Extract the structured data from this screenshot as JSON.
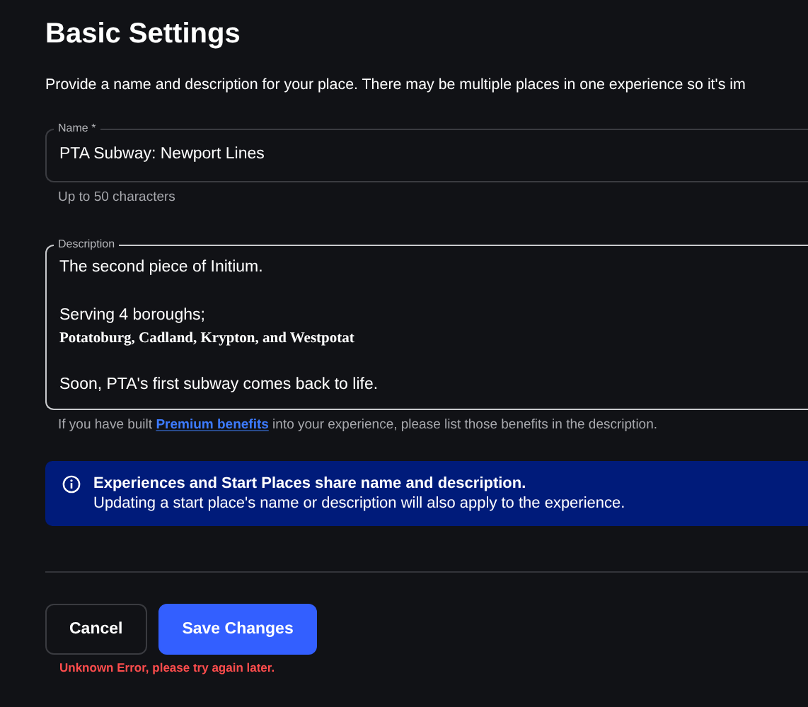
{
  "title": "Basic Settings",
  "subtitle": "Provide a name and description for your place. There may be multiple places in one experience so it's im",
  "name_field": {
    "label": "Name *",
    "value": "PTA Subway: Newport Lines",
    "hint": "Up to 50 characters"
  },
  "description_field": {
    "label": "Description",
    "focused": true,
    "paragraphs": [
      {
        "lines": [
          {
            "text": "The second piece of Initium.",
            "kind": "plain"
          }
        ]
      },
      {
        "lines": [
          {
            "text": "Serving 4 boroughs;",
            "kind": "plain"
          },
          {
            "text": "Potatoburg, Cadland, Krypton, and Westpotat",
            "kind": "fancy"
          }
        ]
      },
      {
        "lines": [
          {
            "text": "Soon, PTA's first subway comes back to life.",
            "kind": "plain"
          }
        ]
      }
    ],
    "hint_before": "If you have built ",
    "hint_link": "Premium benefits",
    "hint_after": " into your experience, please list those benefits in the description."
  },
  "banner": {
    "heading": "Experiences and Start Places share name and description.",
    "body": "Updating a start place's name or description will also apply to the experience."
  },
  "buttons": [
    {
      "label": "Cancel",
      "kind": "secondary"
    },
    {
      "label": "Save Changes",
      "kind": "primary"
    }
  ],
  "error": "Unknown Error, please try again later."
}
